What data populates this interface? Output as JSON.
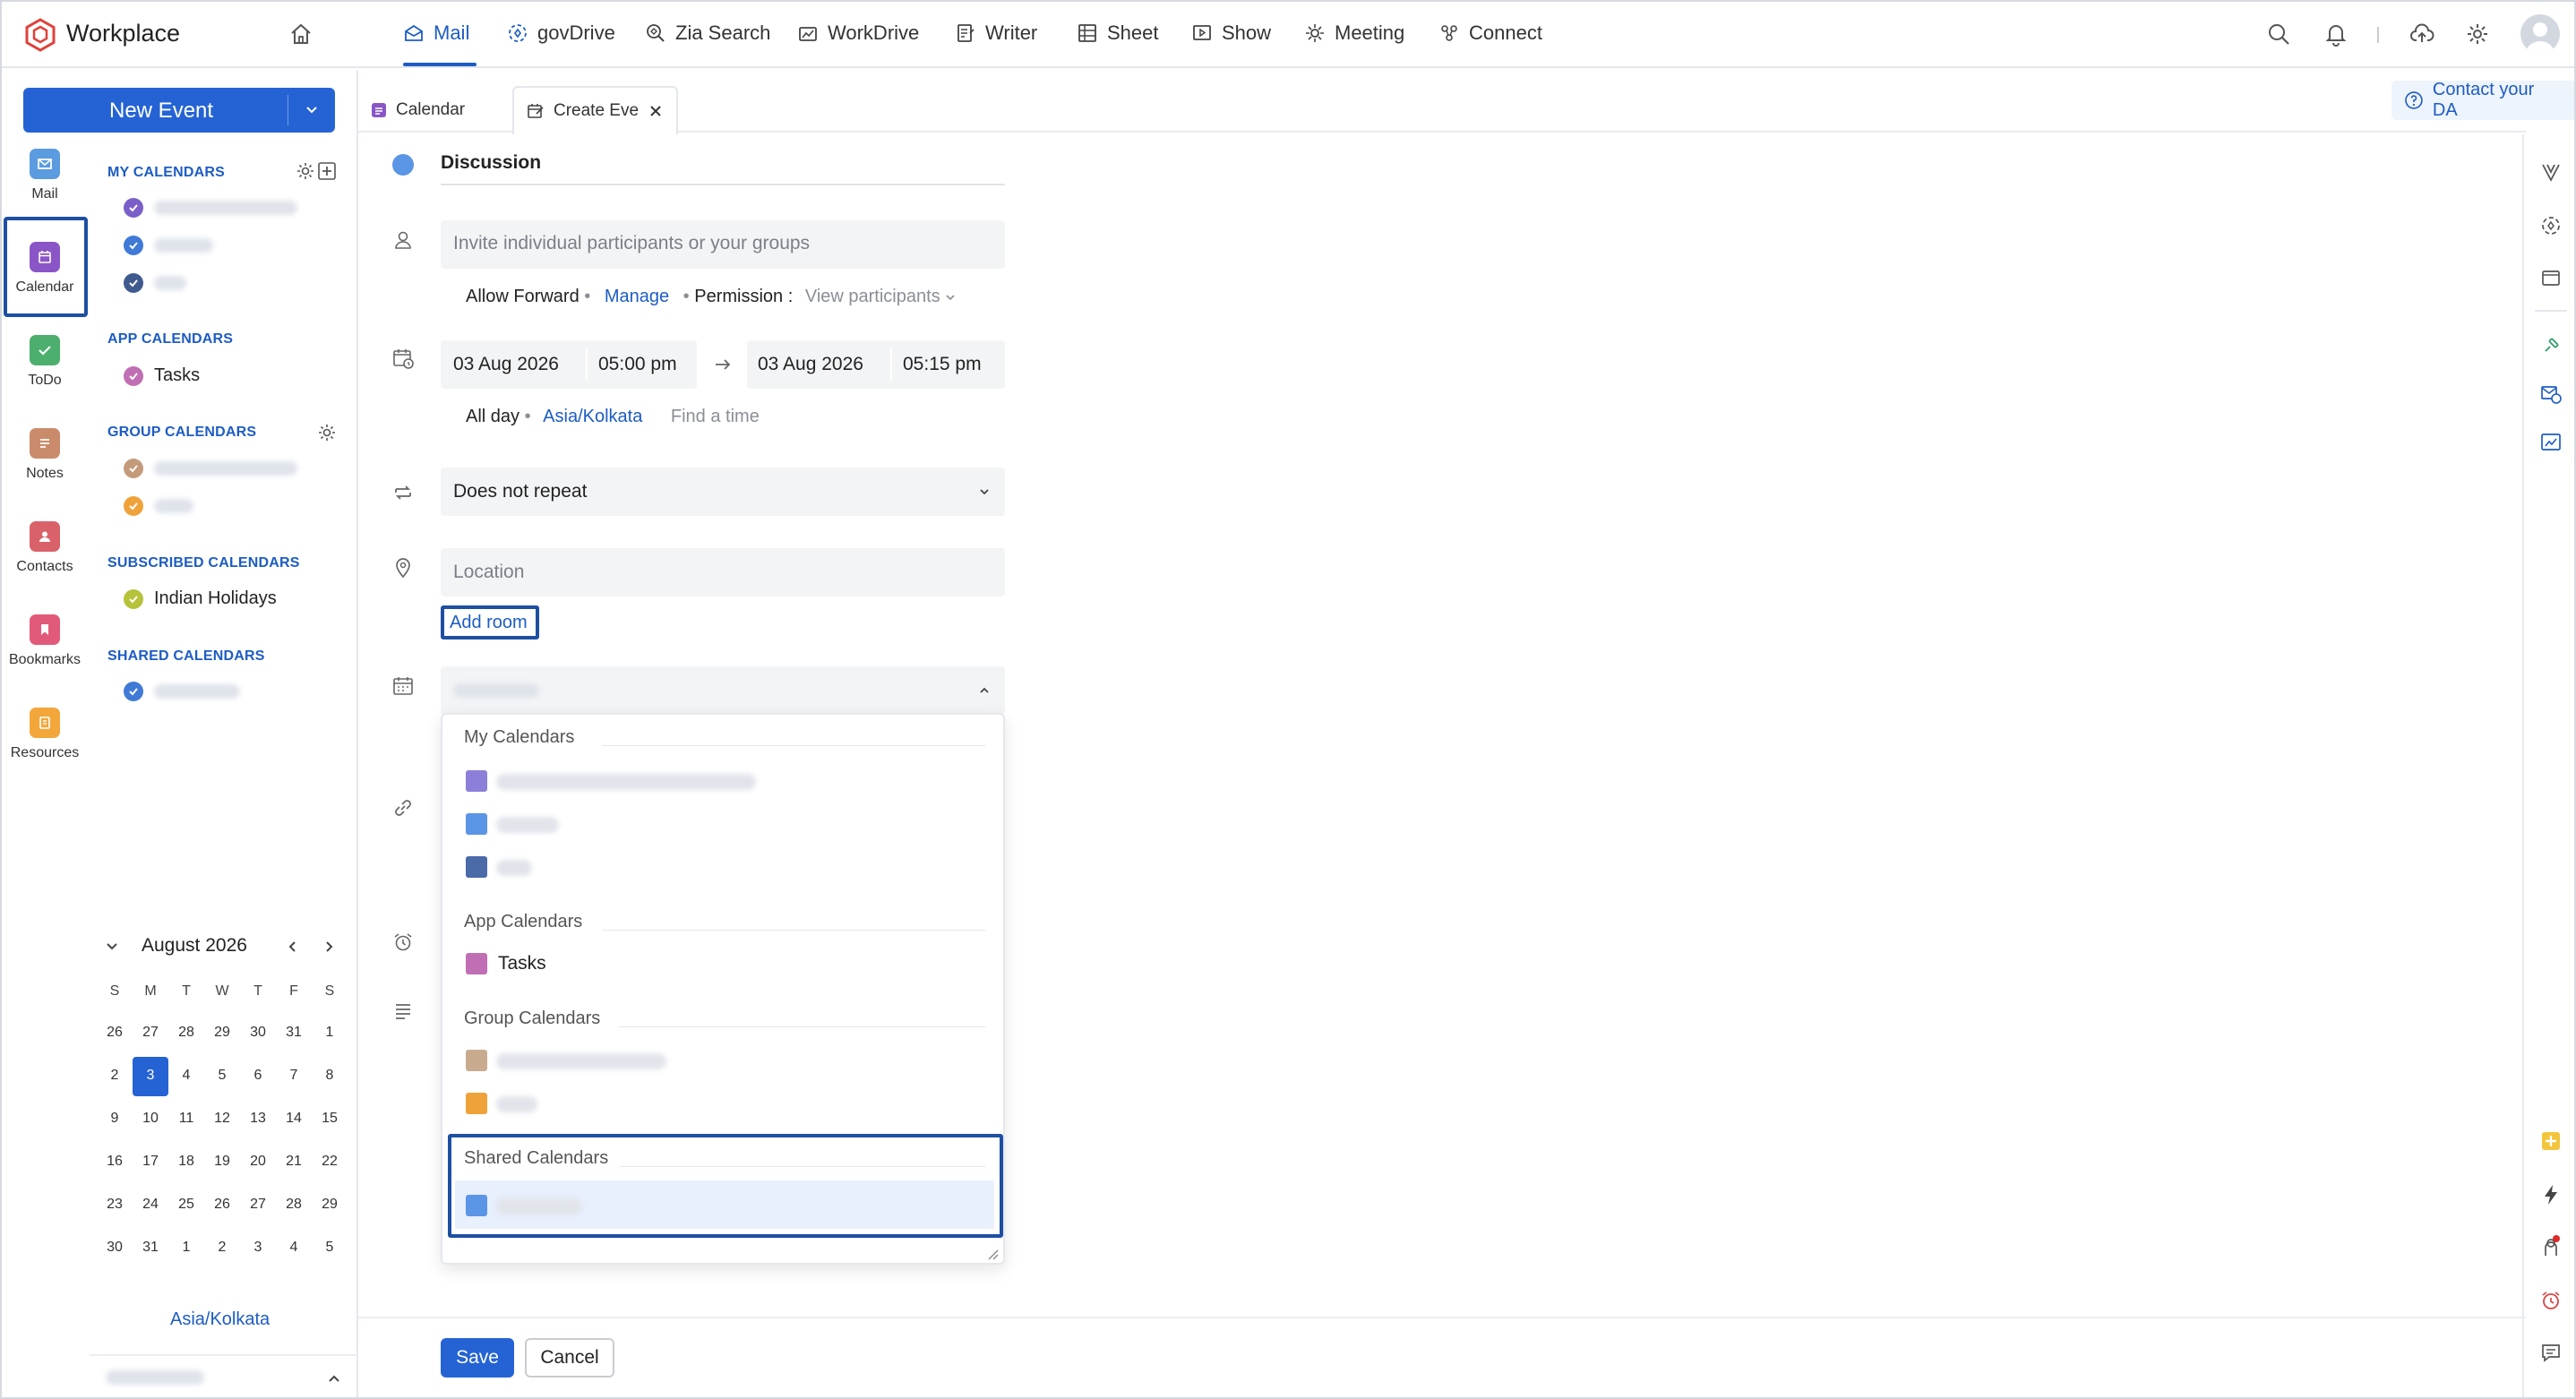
{
  "app": {
    "brand": "Workplace"
  },
  "topnav": {
    "items": [
      {
        "label": "Mail",
        "icon": "mail-icon",
        "active": true
      },
      {
        "label": "govDrive",
        "icon": "govdrive-icon"
      },
      {
        "label": "Zia Search",
        "icon": "zia-search-icon"
      },
      {
        "label": "WorkDrive",
        "icon": "workdrive-icon"
      },
      {
        "label": "Writer",
        "icon": "writer-icon"
      },
      {
        "label": "Sheet",
        "icon": "sheet-icon"
      },
      {
        "label": "Show",
        "icon": "show-icon"
      },
      {
        "label": "Meeting",
        "icon": "meeting-icon"
      },
      {
        "label": "Connect",
        "icon": "connect-icon"
      }
    ]
  },
  "rail": {
    "items": [
      {
        "label": "Mail",
        "color": "#5b9be0"
      },
      {
        "label": "Calendar",
        "color": "#8a55c7"
      },
      {
        "label": "ToDo",
        "color": "#4caf6d"
      },
      {
        "label": "Notes",
        "color": "#c98b6b"
      },
      {
        "label": "Contacts",
        "color": "#d9626a"
      },
      {
        "label": "Bookmarks",
        "color": "#e25a7a"
      },
      {
        "label": "Resources",
        "color": "#f3a73b"
      }
    ]
  },
  "calendar_panel": {
    "new_event": "New Event",
    "my_calendars_title": "MY CALENDARS",
    "app_calendars_title": "APP CALENDARS",
    "tasks_label": "Tasks",
    "group_calendars_title": "GROUP CALENDARS",
    "subscribed_calendars_title": "SUBSCRIBED CALENDARS",
    "indian_holidays_label": "Indian Holidays",
    "shared_calendars_title": "SHARED CALENDARS",
    "colors": {
      "my1": "#7a5fc9",
      "my2": "#3f7ad6",
      "my3": "#3f5a8f",
      "tasks": "#c06fb4",
      "group1": "#c49b7a",
      "group2": "#f0a23a",
      "holidays": "#b6c23a",
      "shared": "#3f7ad6"
    }
  },
  "mini_calendar": {
    "month_label": "August 2026",
    "weekdays": [
      "S",
      "M",
      "T",
      "W",
      "T",
      "F",
      "S"
    ],
    "weeks": [
      [
        "26",
        "27",
        "28",
        "29",
        "30",
        "31",
        "1"
      ],
      [
        "2",
        "3",
        "4",
        "5",
        "6",
        "7",
        "8"
      ],
      [
        "9",
        "10",
        "11",
        "12",
        "13",
        "14",
        "15"
      ],
      [
        "16",
        "17",
        "18",
        "19",
        "20",
        "21",
        "22"
      ],
      [
        "23",
        "24",
        "25",
        "26",
        "27",
        "28",
        "29"
      ],
      [
        "30",
        "31",
        "1",
        "2",
        "3",
        "4",
        "5"
      ]
    ],
    "selected": "3",
    "timezone": "Asia/Kolkata"
  },
  "tabs": {
    "calendar": "Calendar",
    "create_event": "Create Eve"
  },
  "contact_da": "Contact your DA",
  "form": {
    "title_value": "Discussion",
    "participants_placeholder": "Invite individual participants or your groups",
    "allow_forward": "Allow Forward",
    "manage": "Manage",
    "permission": "Permission :",
    "view_participants": "View participants",
    "start_date": "03 Aug 2026",
    "start_time": "05:00 pm",
    "end_date": "03 Aug 2026",
    "end_time": "05:15 pm",
    "all_day": "All day",
    "timezone": "Asia/Kolkata",
    "find_time": "Find a time",
    "repeat": "Does not repeat",
    "location_placeholder": "Location",
    "add_room": "Add room"
  },
  "dropdown": {
    "my_calendars": "My Calendars",
    "app_calendars": "App Calendars",
    "tasks": "Tasks",
    "group_calendars": "Group Calendars",
    "shared_calendars": "Shared Calendars",
    "colors": {
      "my1": "#8b7fd9",
      "my2": "#5b95e6",
      "my3": "#4a6aa8",
      "tasks": "#c06fb4",
      "group1": "#c8ab8e",
      "group2": "#f0a23a",
      "shared": "#5b95e6"
    }
  },
  "footer": {
    "save": "Save",
    "cancel": "Cancel"
  }
}
